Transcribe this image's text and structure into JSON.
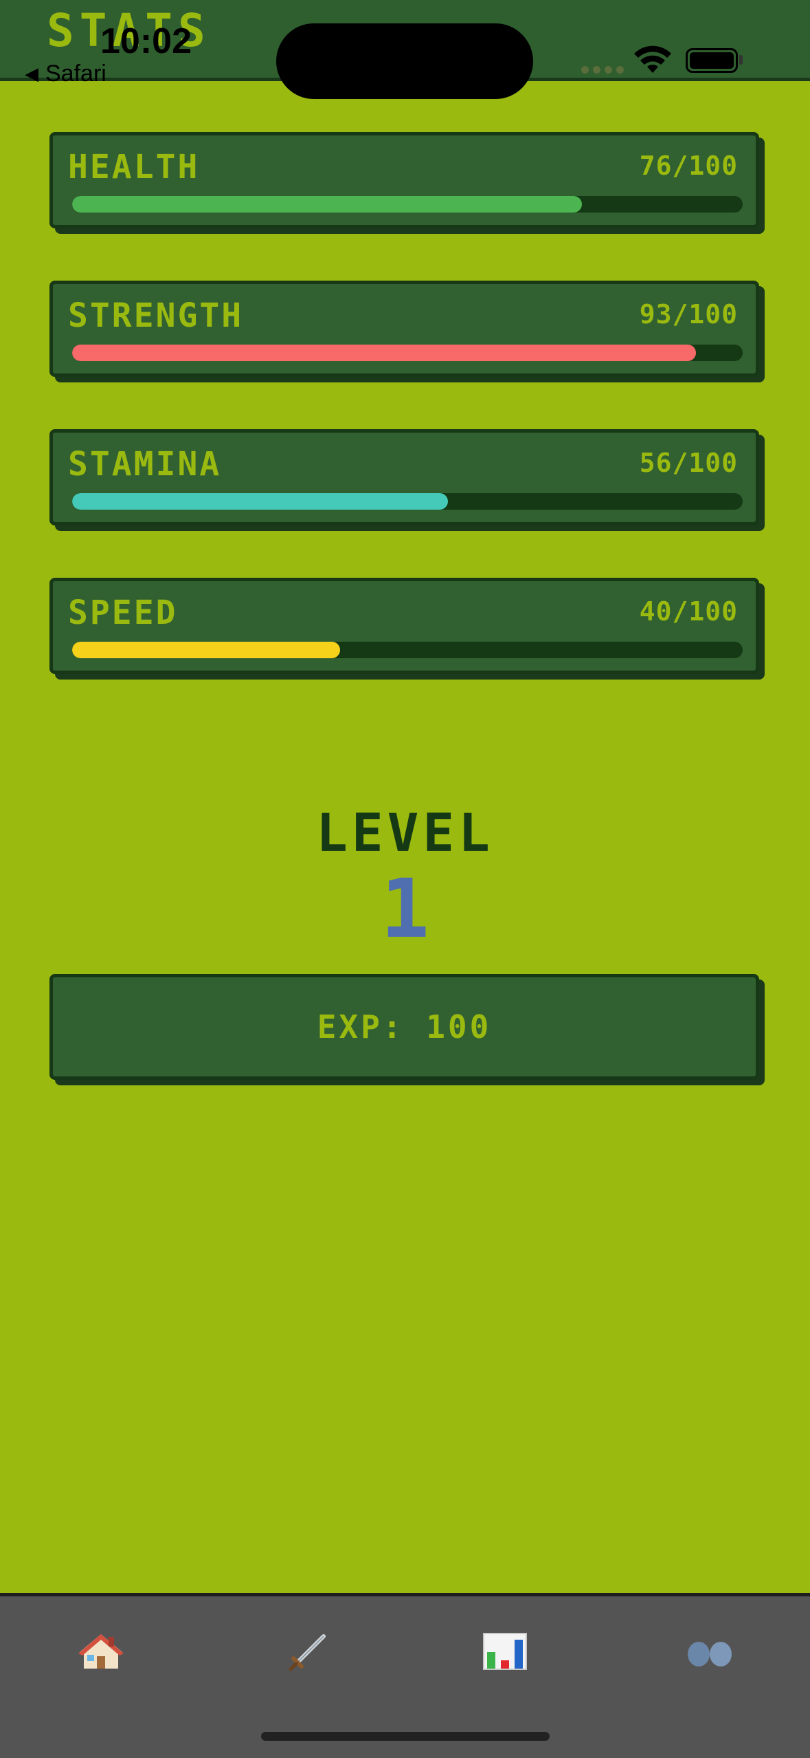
{
  "header": {
    "title": "STATS"
  },
  "status_bar": {
    "time": "10:02",
    "back_label": "Safari"
  },
  "stats": [
    {
      "name": "HEALTH",
      "value_text": "76/100",
      "value": 76,
      "max": 100,
      "color": "#4cb551"
    },
    {
      "name": "STRENGTH",
      "value_text": "93/100",
      "value": 93,
      "max": 100,
      "color": "#f86a6a"
    },
    {
      "name": "STAMINA",
      "value_text": "56/100",
      "value": 56,
      "max": 100,
      "color": "#45c9b8"
    },
    {
      "name": "SPEED",
      "value_text": "40/100",
      "value": 40,
      "max": 100,
      "color": "#f6d21a"
    }
  ],
  "level": {
    "label": "LEVEL",
    "value": "1"
  },
  "exp": {
    "text": "EXP: 100"
  },
  "tabs": [
    {
      "icon": "home-icon"
    },
    {
      "icon": "sword-icon"
    },
    {
      "icon": "bar-chart-icon"
    },
    {
      "icon": "people-icon"
    }
  ],
  "colors": {
    "background": "#9bba10",
    "card": "#316131",
    "text_accent": "#9bba10",
    "level_text": "#143914",
    "level_value": "#4f6fb0",
    "tabbar": "#545454"
  }
}
